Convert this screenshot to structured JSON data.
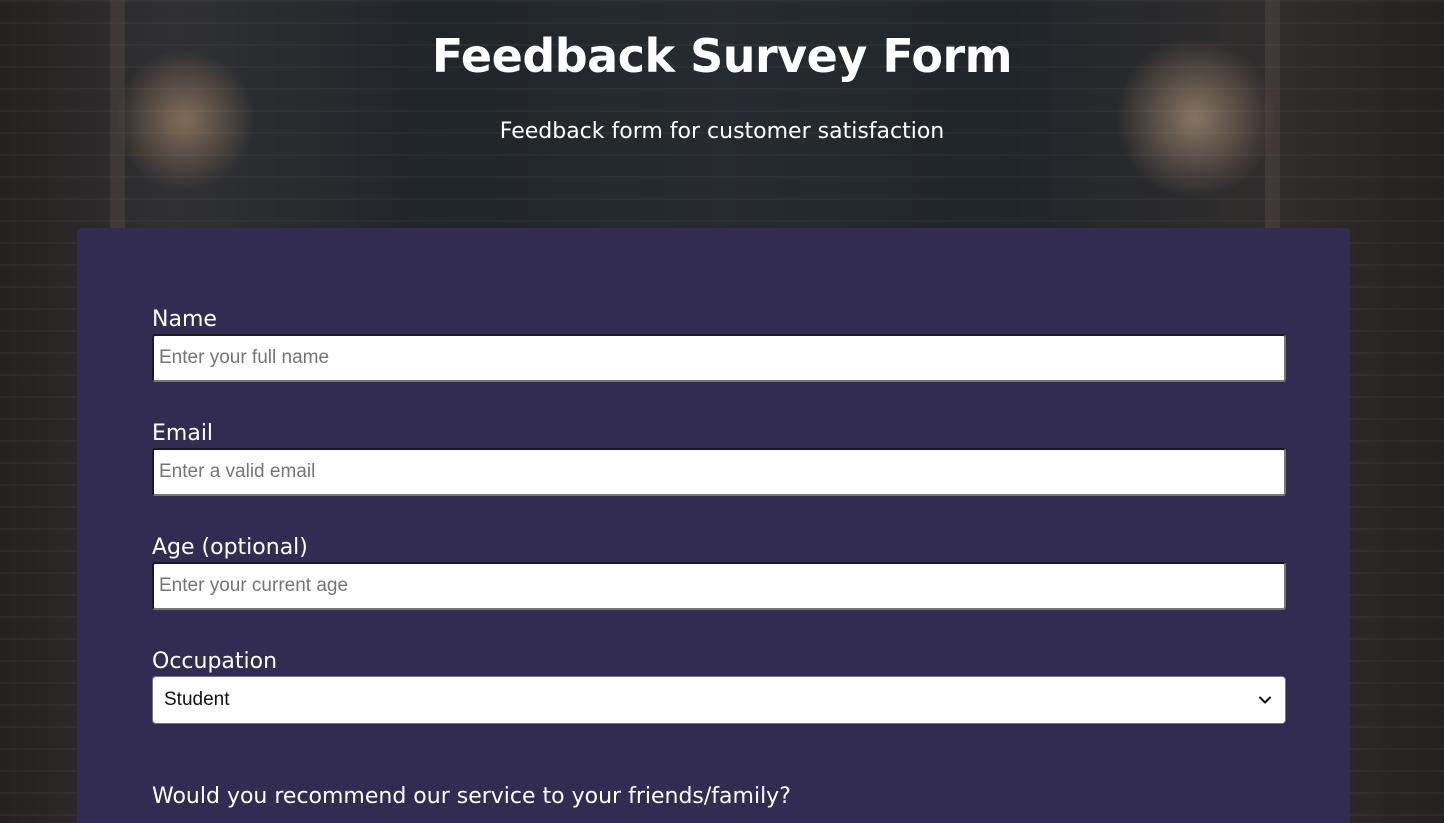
{
  "header": {
    "title": "Feedback Survey Form",
    "description": "Feedback form for customer satisfaction"
  },
  "form": {
    "background_color": "#322c53",
    "fields": {
      "name": {
        "label": "Name",
        "placeholder": "Enter your full name",
        "value": ""
      },
      "email": {
        "label": "Email",
        "placeholder": "Enter a valid email",
        "value": ""
      },
      "age": {
        "label": "Age (optional)",
        "placeholder": "Enter your current age",
        "value": ""
      },
      "occupation": {
        "label": "Occupation",
        "selected": "Student",
        "icon": "chevron-down-icon"
      }
    },
    "recommend_question": "Would you recommend our service to your friends/family?"
  }
}
